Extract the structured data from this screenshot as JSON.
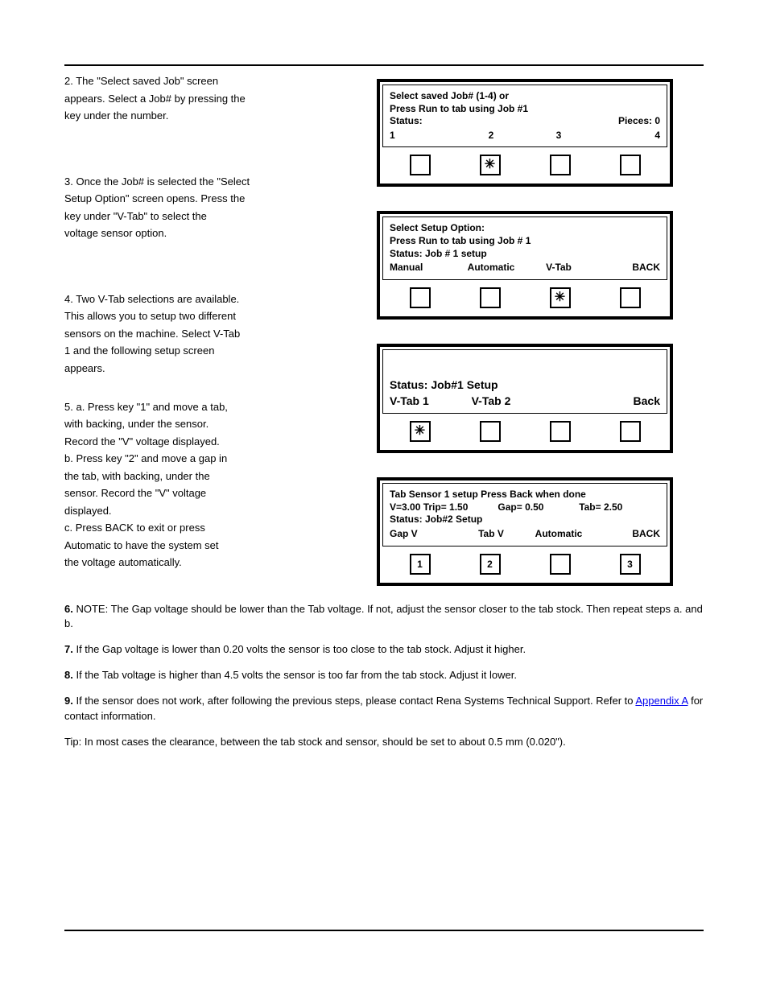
{
  "leftcol": {
    "para1a": "2.",
    "para1b": "The \"Select saved Job\" screen",
    "para1c": "appears. Select a Job# by pressing the",
    "para1d": "key under the number.",
    "para2a": "3.",
    "para2b": "Once the Job# is selected the \"Select",
    "para2c": "Setup Option\" screen opens. Press the",
    "para2d": "key under \"V-Tab\" to select the",
    "para2e": "voltage sensor option.",
    "para3a": "4.",
    "para3b": "Two V-Tab selections are available.",
    "para3c": "This allows you to setup two different",
    "para3d": "sensors on the machine. Select V-Tab",
    "para3e": "1 and the following setup screen",
    "para3f": "appears.",
    "para4a": "5.",
    "para4b": "a. Press key \"1\" and move a tab,",
    "para4c": "with backing, under the sensor.",
    "para4d": "Record the \"V\" voltage displayed.",
    "para4e": "b. Press key \"2\" and move a gap in",
    "para4f": "the tab, with backing, under the",
    "para4g": "sensor. Record the \"V\" voltage",
    "para4h": "displayed.",
    "para4i": "c. Press BACK to exit or press",
    "para4j": "Automatic to have the system set",
    "para4k": "the voltage automatically."
  },
  "panel1": {
    "l1": "Select saved Job# (1-4) or",
    "l2": "Press Run to tab using Job #1",
    "status_label": "Status:",
    "pieces": "Pieces: 0",
    "c1": "1",
    "c2": "2",
    "c3": "3",
    "c4": "4"
  },
  "panel2": {
    "l1": "Select Setup Option:",
    "l2": "Press Run to tab using Job # 1",
    "l3": "Status: Job # 1 setup",
    "o1": "Manual",
    "o2": "Automatic",
    "o3": "V-Tab",
    "o4": "BACK"
  },
  "panel3": {
    "l1": "Status: Job#1 Setup",
    "o1": "V-Tab 1",
    "o2": "V-Tab 2",
    "o4": "Back"
  },
  "panel4": {
    "l1": "Tab Sensor 1 setup Press Back when done",
    "l2a": "V=3.00  Trip= 1.50",
    "l2b": "Gap= 0.50",
    "l2c": "Tab= 2.50",
    "l3": "Status: Job#2 Setup",
    "o1": "Gap V",
    "o2": "Tab V",
    "o3": "Automatic",
    "o4": "BACK",
    "b1": "1",
    "b2": "2",
    "b3": "3"
  },
  "notes": {
    "n1_num": "6.",
    "n1_title": "NOTE: The Gap voltage should be lower than the Tab voltage.",
    "n1_body": " If not, adjust the sensor closer to the tab stock. Then repeat steps a. and b.",
    "n2_num": "7.",
    "n2_body_a": "If the Gap voltage is lower than 0.20 volts the sensor is too close to the tab stock. Adjust it higher.",
    "n3_num": "8.",
    "n3_body_a": "If the Tab voltage is higher than 4.5 volts the sensor is too far from the tab stock. Adjust it lower.",
    "n4_num": "9.",
    "n4_body_a": "If the sensor does not work, after following the previous steps, please contact Rena Systems Technical Support. Refer to ",
    "n4_link": "Appendix A",
    "n4_body_b": " for contact information.",
    "tip_title": "Tip:",
    "tip_body": " In most cases the clearance, between the tab stock and sensor, should be set to about 0.5 mm (0.020\")."
  }
}
